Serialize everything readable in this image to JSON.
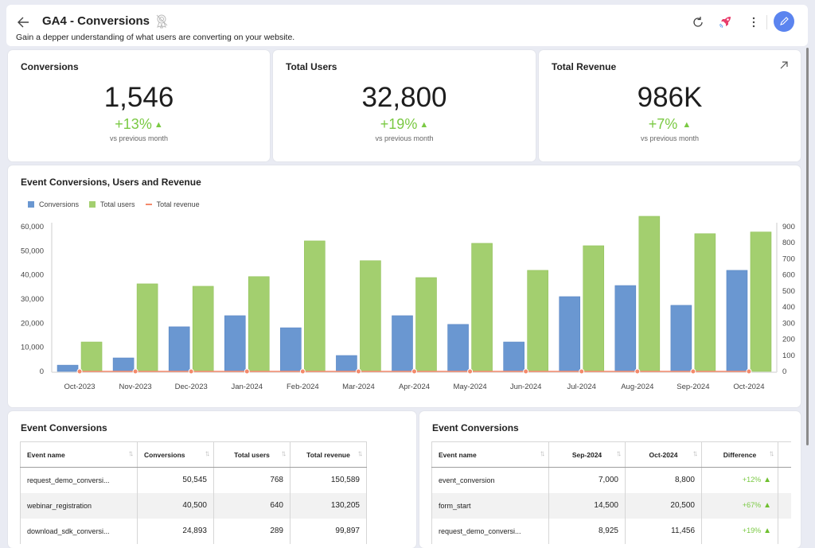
{
  "header": {
    "title": "GA4 - Conversions",
    "subtitle": "Gain a depper understanding of what users are converting on your website.",
    "icons": [
      "back-arrow-icon",
      "certificate-icon",
      "refresh-icon",
      "rocket-icon",
      "more-vertical-icon",
      "edit-pencil-icon"
    ]
  },
  "kpis": [
    {
      "title": "Conversions",
      "value": "1,546",
      "delta": "+13%",
      "trend": "up",
      "sub": "vs previous month"
    },
    {
      "title": "Total Users",
      "value": "32,800",
      "delta": "+19%",
      "trend": "up",
      "sub": "vs previous month"
    },
    {
      "title": "Total Revenue",
      "value": "986K",
      "delta": "+7%",
      "trend": "up",
      "sub": "vs previous month"
    }
  ],
  "colors": {
    "conversions": "#6a97d1",
    "users": "#a3cf6f",
    "revenue": "#f4896b",
    "positive": "#7ac943",
    "accent": "#5b84ef"
  },
  "chart_data": {
    "type": "bar",
    "title": "Event Conversions, Users and Revenue",
    "categories": [
      "Oct-2023",
      "Nov-2023",
      "Dec-2023",
      "Jan-2024",
      "Feb-2024",
      "Mar-2024",
      "Apr-2024",
      "May-2024",
      "Jun-2024",
      "Jul-2024",
      "Aug-2024",
      "Sep-2024",
      "Oct-2024"
    ],
    "series": [
      {
        "name": "Conversions",
        "type": "bar",
        "axis": "left",
        "values": [
          2600,
          5600,
          18500,
          23100,
          18100,
          6600,
          23100,
          19500,
          12200,
          31000,
          35600,
          27400,
          41900
        ]
      },
      {
        "name": "Total users",
        "type": "bar",
        "axis": "left",
        "values": [
          12200,
          36300,
          35300,
          39300,
          54100,
          45900,
          38900,
          53100,
          41900,
          52100,
          64300,
          57100,
          57800
        ]
      },
      {
        "name": "Total revenue",
        "type": "line",
        "axis": "right",
        "values": [
          0,
          0,
          0,
          0,
          0,
          0,
          0,
          0,
          0,
          0,
          0,
          0,
          0
        ]
      }
    ],
    "y_left": {
      "min": 0,
      "max": 60000,
      "ticks": [
        "0",
        "10,000",
        "20,000",
        "30,000",
        "40,000",
        "50,000",
        "60,000"
      ]
    },
    "y_right": {
      "min": 0,
      "max": 900,
      "ticks": [
        "0",
        "100",
        "200",
        "300",
        "400",
        "500",
        "600",
        "700",
        "800",
        "900"
      ]
    },
    "legend": "top-left",
    "grid": false
  },
  "table1": {
    "title": "Event Conversions",
    "columns": [
      "Event name",
      "Conversions",
      "Total users",
      "Total revenue"
    ],
    "rows": [
      [
        "request_demo_conversi...",
        "50,545",
        "768",
        "150,589"
      ],
      [
        "webinar_registration",
        "40,500",
        "640",
        "130,205"
      ],
      [
        "download_sdk_conversi...",
        "24,893",
        "289",
        "99,897"
      ]
    ]
  },
  "table2": {
    "title": "Event Conversions",
    "columns": [
      "Event name",
      "Sep-2024",
      "Oct-2024",
      "Difference"
    ],
    "rows": [
      [
        "event_conversion",
        "7,000",
        "8,800",
        "+12%"
      ],
      [
        "form_start",
        "14,500",
        "20,500",
        "+67%"
      ],
      [
        "request_demo_conversi...",
        "8,925",
        "11,456",
        "+19%"
      ]
    ]
  },
  "symbols": {
    "up": "▲",
    "sort": "↑↓"
  }
}
